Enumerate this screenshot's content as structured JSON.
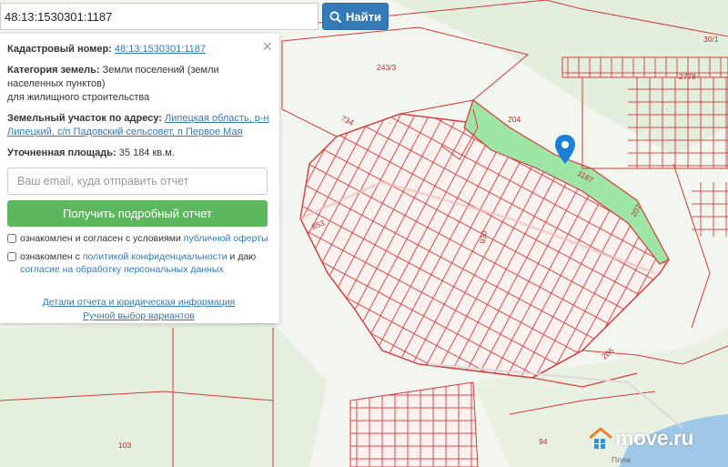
{
  "search": {
    "value": "48:13:1530301:1187",
    "button_label": "Найти"
  },
  "panel": {
    "cadastral_label": "Кадастровый номер:",
    "cadastral_value": "48:13:1530301:1187",
    "category_label": "Категория земель:",
    "category_value": "Земли поселений (земли населенных пунктов)",
    "category_use": "для жилищного строительства",
    "address_label": "Земельный участок по адресу:",
    "address_value": "Липецкая область, р-н Липецкий, с/п Падовский сельсовет, п Первое Мая",
    "area_label": "Уточненная площадь:",
    "area_value": "35 184 кв.м.",
    "email_placeholder": "Ваш email, куда отправить отчет",
    "submit_label": "Получить подробный отчет",
    "check1_text": "ознакомлен и согласен с условиями",
    "check1_link": "публичной оферты",
    "check2_text": "ознакомлен с",
    "check2_link": "политикой конфиденциальности",
    "check2_and": "и даю",
    "check2_link2": "согласие на обработку персональных данных",
    "details_link": "Детали отчета и юридическая информация",
    "manual_link": "Ручной выбор вариантов",
    "close_glyph": "×"
  },
  "map": {
    "labels": [
      "243/3",
      "204",
      "30/1",
      "2778",
      "734",
      "1187",
      "207",
      "853",
      "930",
      "206",
      "103",
      "94"
    ],
    "street_label": "Пляж",
    "parcel_color": "#d63a3a",
    "highlight_color": "#9ee6a6"
  },
  "watermark": {
    "text": "move.ru"
  },
  "colors": {
    "primary": "#337ab7",
    "success": "#5cb85c",
    "marker": "#1e7fd6"
  }
}
